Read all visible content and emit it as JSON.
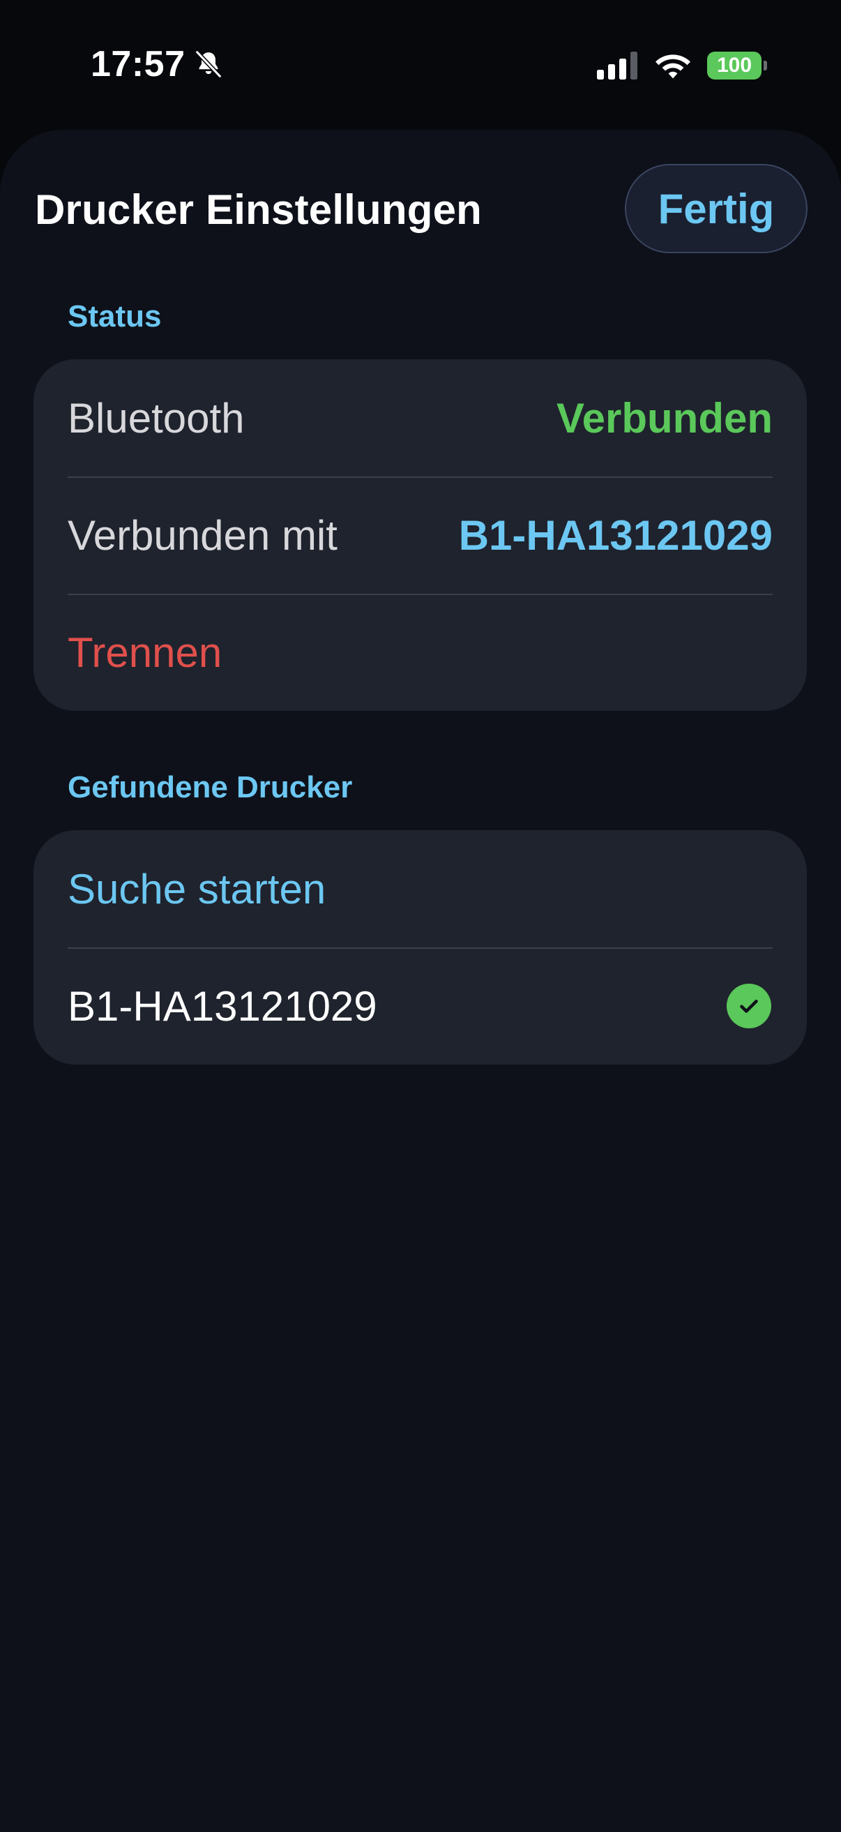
{
  "status_bar": {
    "time": "17:57",
    "battery_level": "100",
    "icons": [
      "bell-slash-icon",
      "cellular-signal-icon",
      "wifi-icon",
      "battery-icon"
    ],
    "battery_color": "#5ac85a"
  },
  "header": {
    "title": "Drucker Einstellungen",
    "done_label": "Fertig"
  },
  "status_section": {
    "header": "Status",
    "rows": [
      {
        "label": "Bluetooth",
        "value": "Verbunden",
        "value_color": "#5ac85a"
      },
      {
        "label": "Verbunden mit",
        "value": "B1-HA13121029",
        "value_color": "#6cc7f2"
      }
    ],
    "disconnect_label": "Trennen",
    "disconnect_color": "#e0504c"
  },
  "printers_section": {
    "header": "Gefundene Drucker",
    "search_label": "Suche starten",
    "devices": [
      {
        "name": "B1-HA13121029",
        "selected": true,
        "icon": "checkmark-circle-icon"
      }
    ]
  },
  "colors": {
    "accent": "#6cc7f2",
    "background": "#0e111a",
    "card": "#1f232d"
  }
}
